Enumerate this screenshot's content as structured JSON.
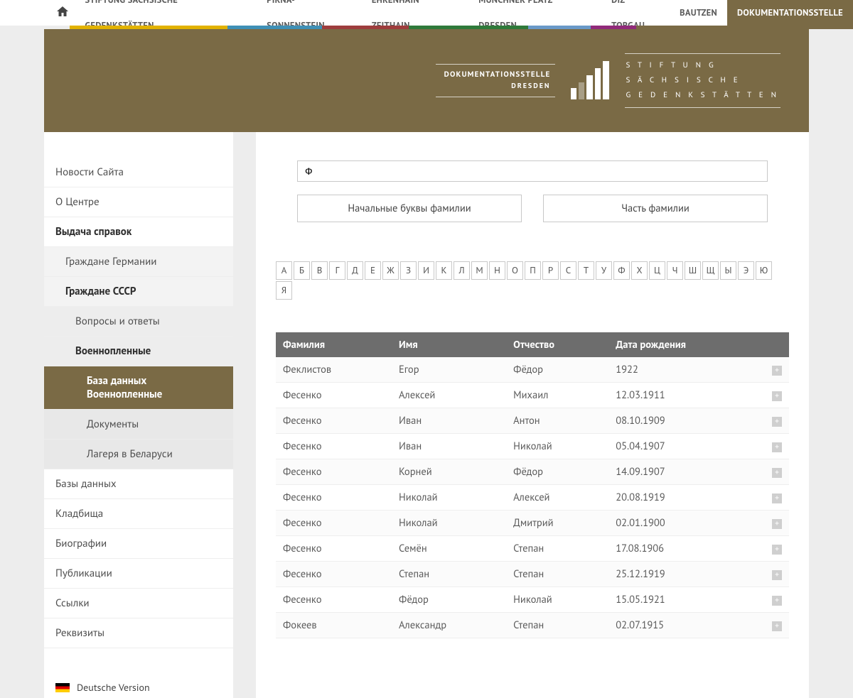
{
  "topnav": {
    "items": [
      {
        "label": "STIFTUNG SÄCHSISCHE GEDENKSTÄTTEN"
      },
      {
        "label": "PIRNA-SONNENSTEIN"
      },
      {
        "label": "EHRENHAIN ZEITHAIN"
      },
      {
        "label": "MÜNCHNER PLATZ DRESDEN"
      },
      {
        "label": "DIZ TORGAU"
      },
      {
        "label": "BAUTZEN"
      },
      {
        "label": "DOKUMENTATIONSSTELLE"
      }
    ]
  },
  "header": {
    "logo1_line1": "DOKUMENTATIONSSTELLE",
    "logo1_line2": "DRESDEN",
    "logo2_line1": "S T I F T U N G",
    "logo2_line2": "S Ä C H S I S C H E",
    "logo2_line3": "G E D E N K S T Ä T T E N"
  },
  "sidebar": {
    "items": [
      {
        "label": "Новости Сайта",
        "level": 0
      },
      {
        "label": "О Центре",
        "level": 0
      },
      {
        "label": "Выдача справок",
        "level": 0,
        "bold": true
      },
      {
        "label": "Граждане Германии",
        "level": 1
      },
      {
        "label": "Граждане СССР",
        "level": 1,
        "bold": true
      },
      {
        "label": "Вопросы и ответы",
        "level": 2
      },
      {
        "label": "Военнопленные",
        "level": 2,
        "bold": true
      },
      {
        "label": "База данных Военнопленные",
        "level": 3,
        "active": true
      },
      {
        "label": "Документы",
        "level": 3
      },
      {
        "label": "Лагеря в Беларуси",
        "level": 3
      },
      {
        "label": "Базы данных",
        "level": 0
      },
      {
        "label": "Кладбища",
        "level": 0
      },
      {
        "label": "Биографии",
        "level": 0
      },
      {
        "label": "Публикации",
        "level": 0
      },
      {
        "label": "Ссылки",
        "level": 0
      },
      {
        "label": "Реквизиты",
        "level": 0
      }
    ],
    "lang_de": "Deutsche Version"
  },
  "search": {
    "value": "Ф",
    "button_initials": "Начальные буквы фамилии",
    "button_part": "Часть фамилии"
  },
  "alphabet": [
    "А",
    "Б",
    "В",
    "Г",
    "Д",
    "Е",
    "Ж",
    "З",
    "И",
    "К",
    "Л",
    "М",
    "Н",
    "О",
    "П",
    "Р",
    "С",
    "Т",
    "У",
    "Ф",
    "Х",
    "Ц",
    "Ч",
    "Ш",
    "Щ",
    "Ы",
    "Э",
    "Ю",
    "Я"
  ],
  "table": {
    "headers": {
      "surname": "Фамилия",
      "name": "Имя",
      "patronymic": "Отчество",
      "dob": "Дата рождения"
    },
    "rows": [
      {
        "surname": "Феклистов",
        "name": "Егор",
        "patronymic": "Фёдор",
        "dob": "1922"
      },
      {
        "surname": "Фесенко",
        "name": "Алексей",
        "patronymic": "Михаил",
        "dob": "12.03.1911"
      },
      {
        "surname": "Фесенко",
        "name": "Иван",
        "patronymic": "Антон",
        "dob": "08.10.1909"
      },
      {
        "surname": "Фесенко",
        "name": "Иван",
        "patronymic": "Николай",
        "dob": "05.04.1907"
      },
      {
        "surname": "Фесенко",
        "name": "Корней",
        "patronymic": "Фёдор",
        "dob": "14.09.1907"
      },
      {
        "surname": "Фесенко",
        "name": "Николай",
        "patronymic": "Алексей",
        "dob": "20.08.1919"
      },
      {
        "surname": "Фесенко",
        "name": "Николай",
        "patronymic": "Дмитрий",
        "dob": "02.01.1900"
      },
      {
        "surname": "Фесенко",
        "name": "Семён",
        "patronymic": "Степан",
        "dob": "17.08.1906"
      },
      {
        "surname": "Фесенко",
        "name": "Степан",
        "patronymic": "Степан",
        "dob": "25.12.1919"
      },
      {
        "surname": "Фесенко",
        "name": "Фёдор",
        "patronymic": "Николай",
        "dob": "15.05.1921"
      },
      {
        "surname": "Фокеев",
        "name": "Александр",
        "patronymic": "Степан",
        "dob": "02.07.1915"
      }
    ]
  }
}
